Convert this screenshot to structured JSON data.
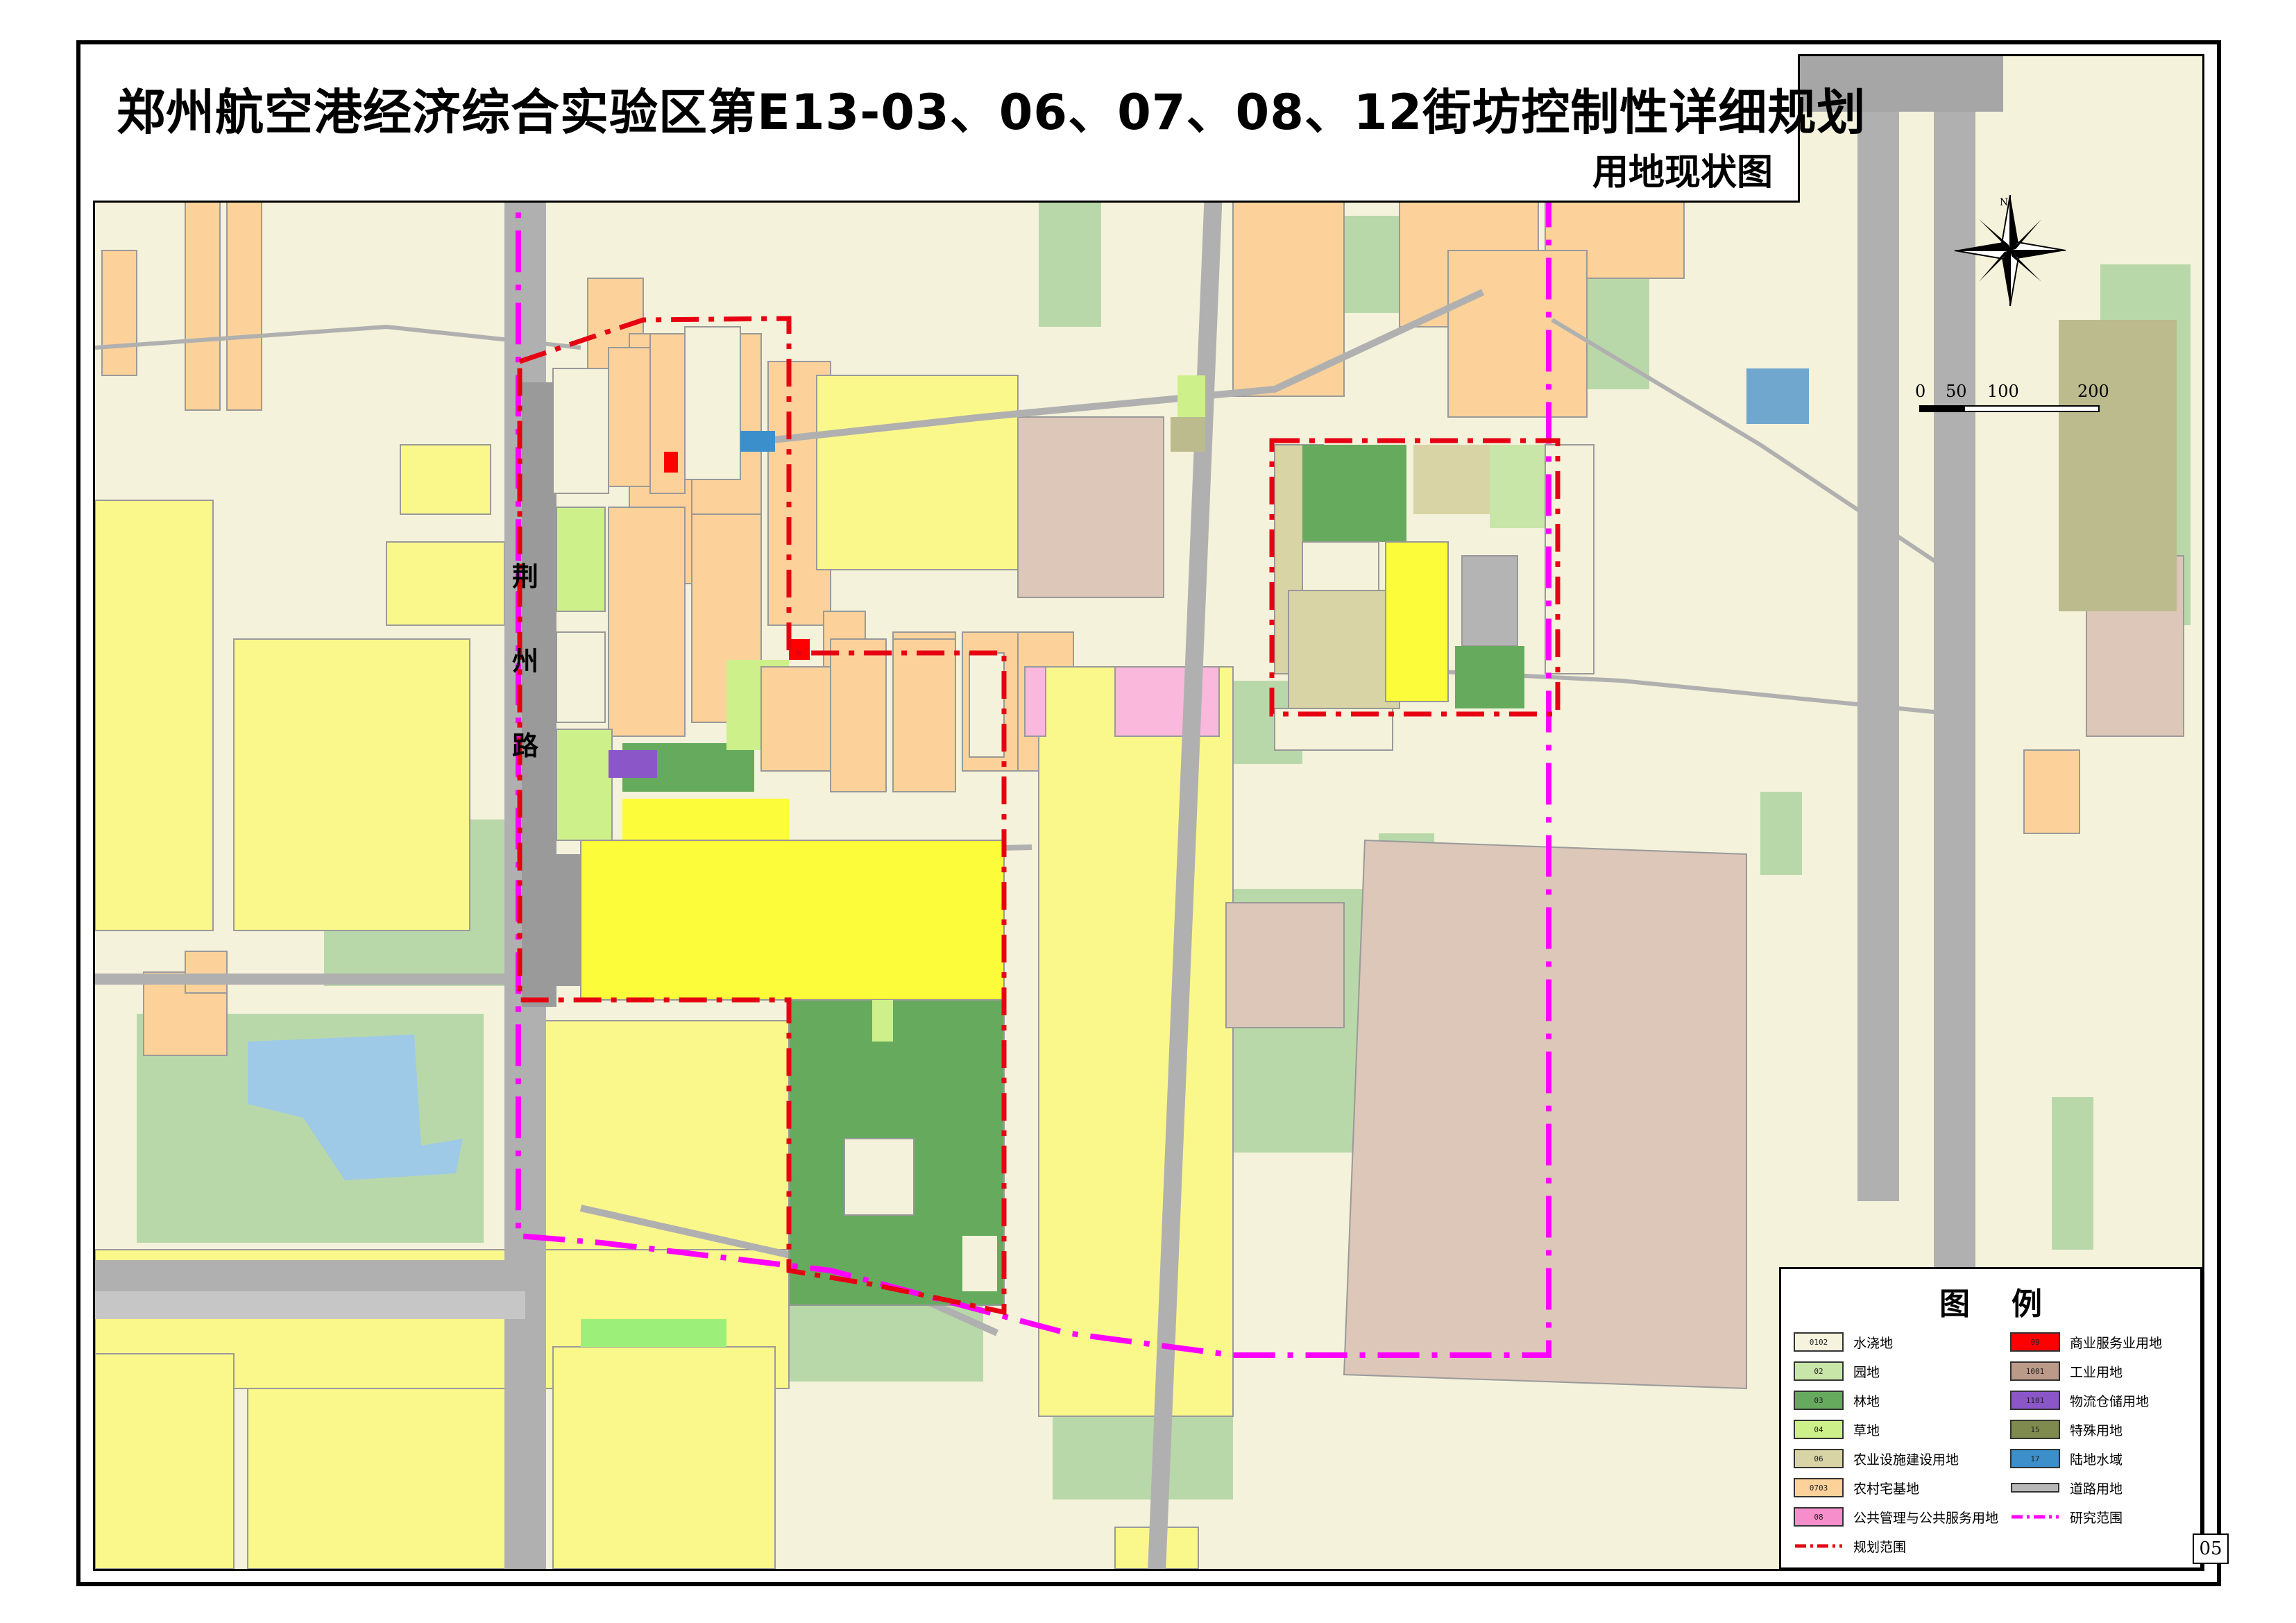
{
  "title": "郑州航空港经济综合实验区第E13-03、06、07、08、12街坊控制性详细规划",
  "subtitle": "用地现状图",
  "road_label": [
    "荆",
    "州",
    "路"
  ],
  "north": "N",
  "scale": {
    "ticks": [
      "0",
      "50",
      "100",
      "200"
    ]
  },
  "page_number": "05",
  "legend": {
    "title": "图例",
    "items": [
      {
        "code": "0102",
        "label": "水浇地",
        "color": "#f5f3de"
      },
      {
        "code": "02",
        "label": "园地",
        "color": "#c8e6a8"
      },
      {
        "code": "03",
        "label": "林地",
        "color": "#66aa5e"
      },
      {
        "code": "04",
        "label": "草地",
        "color": "#cdf08a"
      },
      {
        "code": "06",
        "label": "农业设施建设用地",
        "color": "#d8d4a6"
      },
      {
        "code": "0703",
        "label": "农村宅基地",
        "color": "#fcd29a"
      },
      {
        "code": "08",
        "label": "公共管理与公共服务用地",
        "color": "#f68ecb"
      },
      {
        "code": "09",
        "label": "商业服务业用地",
        "color": "#ff0000"
      },
      {
        "code": "1001",
        "label": "工业用地",
        "color": "#bb9a8a"
      },
      {
        "code": "1101",
        "label": "物流仓储用地",
        "color": "#8a56c8"
      },
      {
        "code": "15",
        "label": "特殊用地",
        "color": "#7e8a4e"
      },
      {
        "code": "17",
        "label": "陆地水域",
        "color": "#3b8fcb"
      },
      {
        "code": "",
        "label": "道路用地",
        "color": "#b8b8b8"
      },
      {
        "code": "",
        "label": "研究范围",
        "color": "#ff00ff"
      },
      {
        "code": "",
        "label": "规划范围",
        "color": "#e60012"
      }
    ]
  },
  "colors": {
    "background": "#f5f3de",
    "road": "#b8b8b8",
    "study_boundary": "#ff00ff",
    "plan_boundary": "#e60012"
  }
}
